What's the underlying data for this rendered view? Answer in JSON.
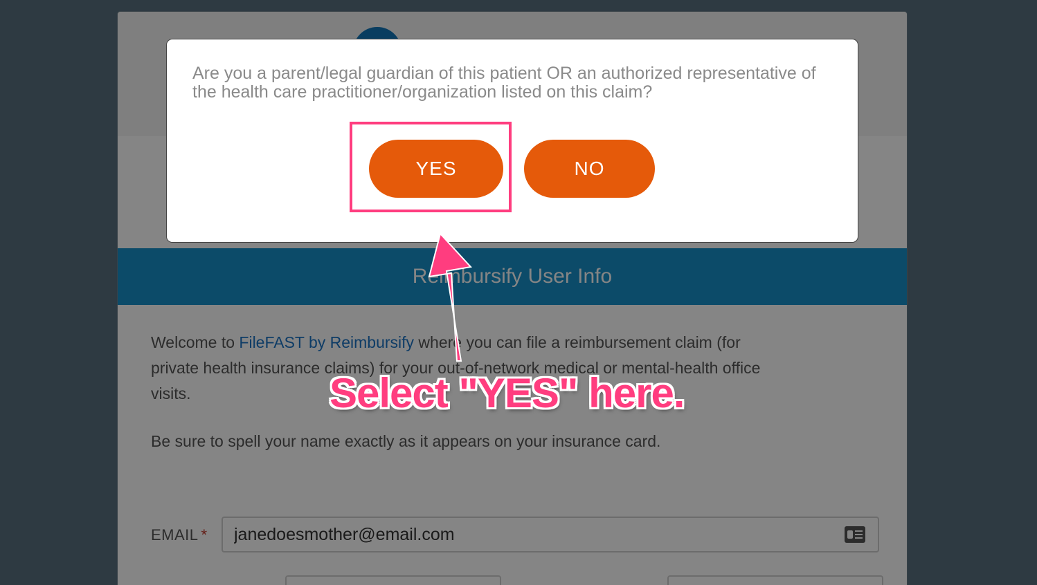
{
  "modal": {
    "question": "Are you a parent/legal guardian of this patient OR an authorized representative of the health care practitioner/organization listed on this claim?",
    "yes_label": "YES",
    "no_label": "NO"
  },
  "page": {
    "section_title": "Reimbursify User Info",
    "welcome_prefix": "Welcome to ",
    "welcome_link": "FileFAST by Reimbursify",
    "welcome_suffix": " where you can file a reimbursement claim (for private health insurance claims) for your out-of-network medical or mental-health office visits.",
    "spell_note": "Be sure to spell your name exactly as it appears on your insurance card.",
    "email_label": "EMAIL",
    "email_required": "*",
    "email_value": "janedoesmother@email.com"
  },
  "annotation": {
    "text": "Select \"YES\" here.",
    "color": "#ff3d7f"
  },
  "colors": {
    "accent_button": "#e55a0a",
    "header_bar": "#1790c9",
    "link": "#1b73c4"
  }
}
